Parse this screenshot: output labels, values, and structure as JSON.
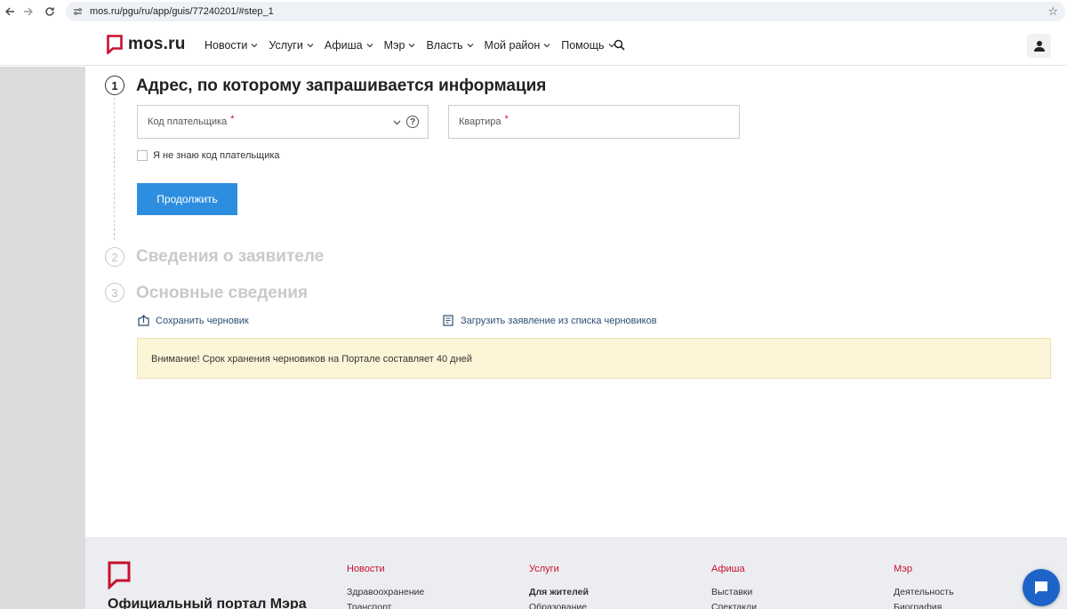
{
  "browser": {
    "url": "mos.ru/pgu/ru/app/guis/77240201/#step_1"
  },
  "header": {
    "logo_text": "mos.ru",
    "nav": [
      {
        "label": "Новости"
      },
      {
        "label": "Услуги"
      },
      {
        "label": "Афиша"
      },
      {
        "label": "Мэр"
      },
      {
        "label": "Власть"
      },
      {
        "label": "Мой район"
      },
      {
        "label": "Помощь"
      }
    ]
  },
  "form": {
    "steps": [
      {
        "num": "1",
        "title": "Адрес, по которому запрашивается информация",
        "active": true
      },
      {
        "num": "2",
        "title": "Сведения о заявителе",
        "active": false
      },
      {
        "num": "3",
        "title": "Основные сведения",
        "active": false
      }
    ],
    "payer_code": {
      "label": "Код плательщика",
      "required_mark": "*"
    },
    "apartment": {
      "label": "Квартира",
      "required_mark": "*"
    },
    "unknown_code_label": "Я не знаю код плательщика",
    "continue_label": "Продолжить",
    "save_draft_label": "Сохранить черновик",
    "load_draft_label": "Загрузить заявление из списка черновиков",
    "notice": "Внимание! Срок хранения черновиков на Портале составляет 40 дней"
  },
  "footer": {
    "title": "Официальный портал Мэра",
    "columns": [
      {
        "head": "Новости",
        "items": [
          "Здравоохранение",
          "Транспорт"
        ]
      },
      {
        "head": "Услуги",
        "items": [
          "Для жителей",
          "Образование"
        ]
      },
      {
        "head": "Афиша",
        "items": [
          "Выставки",
          "Спектакли"
        ]
      },
      {
        "head": "Мэр",
        "items": [
          "Деятельность",
          "Биография"
        ]
      }
    ]
  },
  "colors": {
    "brand_red": "#c8102e",
    "primary_blue": "#2d8ee0",
    "notice_bg": "#fdf5d7",
    "chat_blue": "#1e63c7"
  }
}
